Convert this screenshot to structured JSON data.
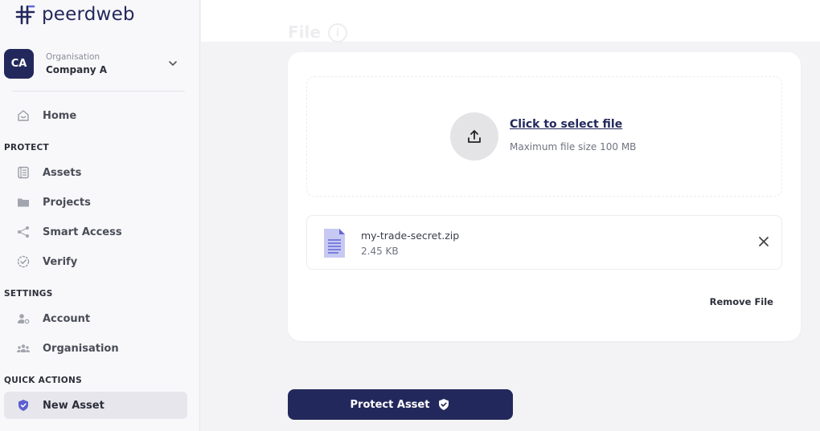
{
  "brand": {
    "name": "peerdweb",
    "color": "#23285c"
  },
  "organisation": {
    "avatar_initials": "CA",
    "label": "Organisation",
    "name": "Company A"
  },
  "sidebar": {
    "home": {
      "label": "Home",
      "icon": "home-icon"
    },
    "sections": [
      {
        "title": "PROTECT",
        "items": [
          {
            "label": "Assets",
            "icon": "assets-icon"
          },
          {
            "label": "Projects",
            "icon": "folder-icon"
          },
          {
            "label": "Smart Access",
            "icon": "share-icon"
          },
          {
            "label": "Verify",
            "icon": "verify-badge-icon"
          }
        ]
      },
      {
        "title": "SETTINGS",
        "items": [
          {
            "label": "Account",
            "icon": "account-icon"
          },
          {
            "label": "Organisation",
            "icon": "team-icon"
          }
        ]
      },
      {
        "title": "QUICK ACTIONS",
        "items": [
          {
            "label": "New Asset",
            "icon": "shield-icon",
            "active": true
          }
        ]
      }
    ]
  },
  "page": {
    "title": "File",
    "info_icon": "info-icon"
  },
  "dropzone": {
    "link_text": "Click to select file",
    "hint": "Maximum file size 100 MB",
    "icon": "upload-icon"
  },
  "file": {
    "name": "my-trade-secret.zip",
    "size": "2.45 KB",
    "icon": "document-icon",
    "remove_icon": "close-icon"
  },
  "remove_label": "Remove File",
  "protect_label": "Protect Asset",
  "colors": {
    "primary": "#23285c",
    "file_icon": "#c7c9f2",
    "file_icon_accent": "#6266d6"
  }
}
